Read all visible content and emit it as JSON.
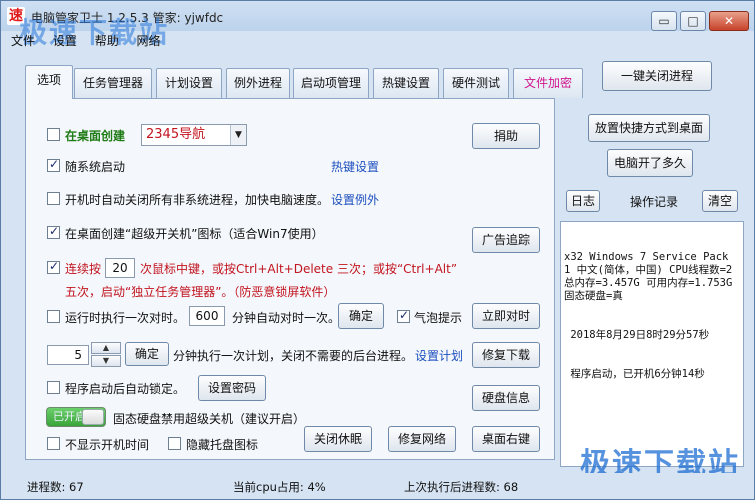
{
  "app": {
    "icon_glyph": "速",
    "title": "电脑管家卫士 1.2.5.3   管家: yjwfdc",
    "watermark_top": "极速下载站",
    "watermark_bottom": "极速下载站"
  },
  "window_controls": {
    "minimize": "▭",
    "maximize": "□",
    "close": "✕"
  },
  "menu": [
    "文件",
    "设置",
    "帮助",
    "网络"
  ],
  "tabs": [
    {
      "label": "选项"
    },
    {
      "label": "任务管理器"
    },
    {
      "label": "计划设置"
    },
    {
      "label": "例外进程"
    },
    {
      "label": "启动项管理"
    },
    {
      "label": "热键设置"
    },
    {
      "label": "硬件测试"
    },
    {
      "label": "文件加密"
    }
  ],
  "one_key_close_button": "一键关闭进程",
  "options": {
    "desktop_create_label": "在桌面创建",
    "desktop_create_value": "2345导航",
    "donate_button": "捐助",
    "autostart_label": "随系统启动",
    "hotkey_link": "热键设置",
    "close_new_processes_label": "开机时自动关闭所有非系统进程，加快电脑速度。",
    "set_exception_link": "设置例外",
    "super_switch_label": "在桌面创建“超级开关机”图标（适合Win7使用）",
    "ad_block_button": "广告追踪",
    "mouse_click_prefix": "连续按",
    "mouse_click_count": "20",
    "mouse_click_text": "次鼠标中键，或按Ctrl+Alt+Delete 三次；或按“Ctrl+Alt”",
    "mouse_click_text2": "五次，启动“独立任务管理器”。（防恶意锁屏软件）",
    "timer_label": "运行时执行一次对时。",
    "timer_value": "600",
    "timer_text": "分钟自动对时一次。",
    "timer_confirm_button": "确定",
    "bubble_label": "气泡提示",
    "sync_now_button": "立即对时",
    "plan_value": "5",
    "plan_confirm_button": "确定",
    "plan_text": "分钟执行一次计划，关闭不需要的后台进程。",
    "set_plan_link": "设置计划",
    "repair_download_button": "修复下载",
    "autolock_label": "程序启动后自动锁定。",
    "set_password_button": "设置密码",
    "disk_info_button": "硬盘信息",
    "toggle_text": "已开启",
    "ssd_text": "固态硬盘禁用超级关机（建议开启）",
    "hide_boot_time_label": "不显示开机时间",
    "hide_tray_label": "隐藏托盘图标",
    "sleep_off_button": "关闭休眠",
    "repair_network_button": "修复网络",
    "desktop_right_button": "桌面右键"
  },
  "right_panel": {
    "place_shortcut_button": "放置快捷方式到桌面",
    "uptime_button": "电脑开了多久",
    "log_button": "日志",
    "operation_record_label": "操作记录",
    "clear_button": "清空",
    "log_lines": [
      "x32 Windows 7 Service Pack 1 中文(简体，中国) CPU线程数=2 总内存=3.457G 可用内存=1.753G 固态硬盘=真",
      " 2018年8月29日8时29分57秒",
      " 程序启动，已开机6分钟14秒"
    ]
  },
  "status": {
    "process_count": "进程数: 67",
    "cpu_usage": "当前cpu占用: 4%",
    "last_exec": "上次执行后进程数: 68"
  }
}
